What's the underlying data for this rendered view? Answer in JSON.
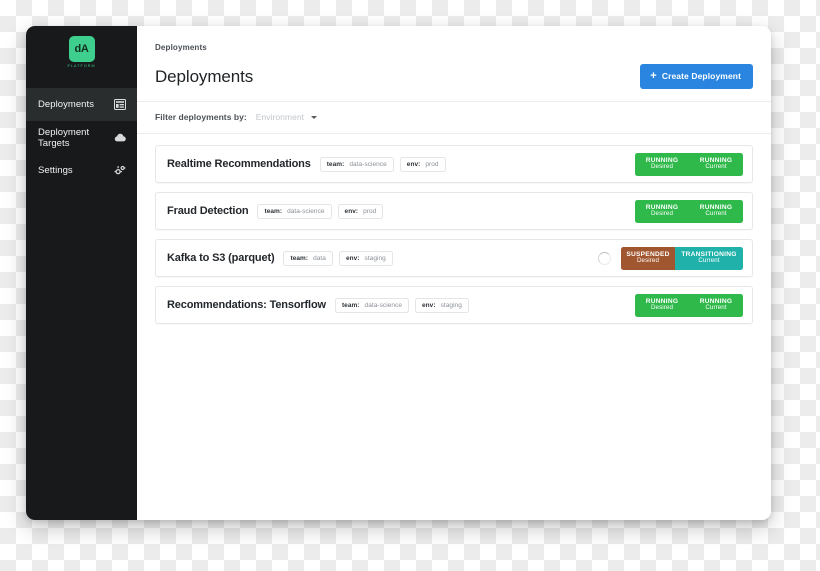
{
  "sidebar": {
    "brand": {
      "mark": "dA",
      "subtitle": "PLATFORM"
    },
    "items": [
      {
        "label": "Deployments",
        "icon": "list-icon",
        "active": true
      },
      {
        "label": "Deployment Targets",
        "icon": "cloud-icon",
        "active": false
      },
      {
        "label": "Settings",
        "icon": "gear-icon",
        "active": false
      }
    ]
  },
  "header": {
    "breadcrumb": "Deployments",
    "title": "Deployments",
    "create_button": {
      "label": "Create Deployment",
      "icon": "plus-icon",
      "color": "#2a85e0"
    }
  },
  "filter": {
    "label": "Filter deployments by:",
    "selected": "Environment",
    "icon": "chevron-down-icon"
  },
  "deployments": [
    {
      "name": "Realtime Recommendations",
      "tags": [
        {
          "key": "team:",
          "value": "data-science"
        },
        {
          "key": "env:",
          "value": "prod"
        }
      ],
      "spinner": false,
      "status": [
        {
          "state": "RUNNING",
          "which": "Desired",
          "color": "#2fb94a"
        },
        {
          "state": "RUNNING",
          "which": "Current",
          "color": "#2fb94a"
        }
      ]
    },
    {
      "name": "Fraud Detection",
      "tags": [
        {
          "key": "team:",
          "value": "data-science"
        },
        {
          "key": "env:",
          "value": "prod"
        }
      ],
      "spinner": false,
      "status": [
        {
          "state": "RUNNING",
          "which": "Desired",
          "color": "#2fb94a"
        },
        {
          "state": "RUNNING",
          "which": "Current",
          "color": "#2fb94a"
        }
      ]
    },
    {
      "name": "Kafka to S3 (parquet)",
      "tags": [
        {
          "key": "team:",
          "value": "data"
        },
        {
          "key": "env:",
          "value": "staging"
        }
      ],
      "spinner": true,
      "status": [
        {
          "state": "SUSPENDED",
          "which": "Desired",
          "color": "#a0562e"
        },
        {
          "state": "TRANSITIONING",
          "which": "Current",
          "color": "#20b2aa"
        }
      ]
    },
    {
      "name": "Recommendations: Tensorflow",
      "tags": [
        {
          "key": "team:",
          "value": "data-science"
        },
        {
          "key": "env:",
          "value": "staging"
        }
      ],
      "spinner": false,
      "status": [
        {
          "state": "RUNNING",
          "which": "Desired",
          "color": "#2fb94a"
        },
        {
          "state": "RUNNING",
          "which": "Current",
          "color": "#2fb94a"
        }
      ]
    }
  ]
}
